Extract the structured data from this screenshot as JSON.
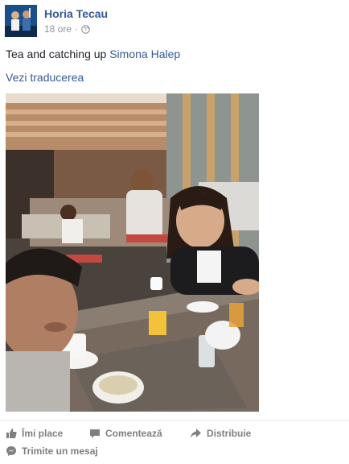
{
  "post": {
    "author": "Horia Tecau",
    "timestamp": "18 ore",
    "separator": "·",
    "privacy_icon": "globe-icon",
    "text_before_mention": "Tea and catching up ",
    "mention": "Simona Halep",
    "translate_link": "Vezi traducerea"
  },
  "photo": {
    "description_icon": "photo"
  },
  "actions": {
    "like_label": "Îmi place",
    "comment_label": "Comentează",
    "share_label": "Distribuie",
    "message_label": "Trimite un mesaj"
  },
  "colors": {
    "link": "#365899",
    "meta": "#90949c",
    "action": "#7f7f7f"
  }
}
